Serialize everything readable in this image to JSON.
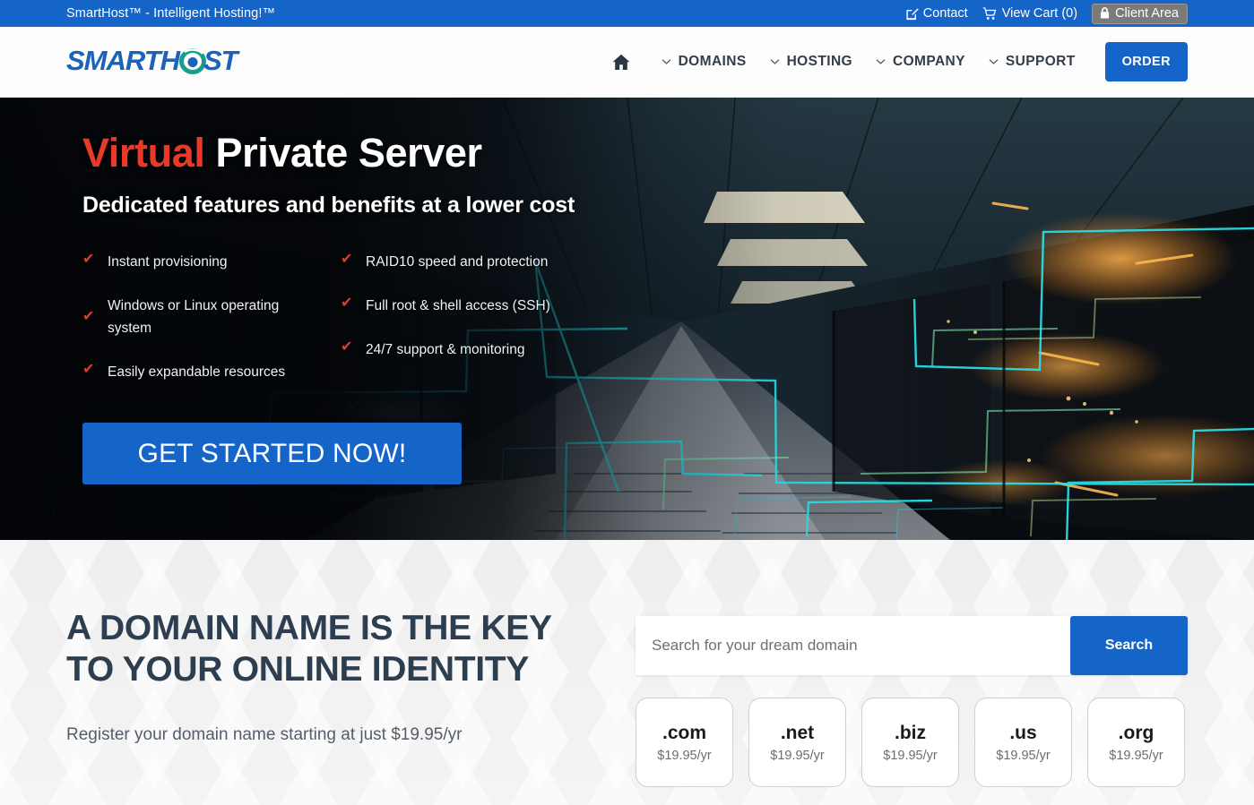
{
  "topbar": {
    "title": "SmartHost™ - Intelligent Hosting!™",
    "contact_label": "Contact",
    "contact_icon": "pencil-square-icon",
    "cart_label": "View Cart (0)",
    "cart_icon": "shopping-cart-icon",
    "client_area_label": "Client Area",
    "client_area_icon": "lock-icon",
    "background_color": "#1565c8",
    "client_area_bg": "#7b7b7b"
  },
  "header": {
    "logo_text": "SMARTHOST",
    "logo_colors": {
      "blue": "#1a63b8",
      "teal": "#189e8e"
    },
    "nav": {
      "home_icon": "home-icon",
      "items": [
        {
          "label": "DOMAINS",
          "icon": "chevron-down-icon"
        },
        {
          "label": "HOSTING",
          "icon": "chevron-down-icon"
        },
        {
          "label": "COMPANY",
          "icon": "chevron-down-icon"
        },
        {
          "label": "SUPPORT",
          "icon": "chevron-down-icon"
        }
      ],
      "order_label": "ORDER",
      "order_color": "#1565c8"
    }
  },
  "hero": {
    "title_accent": "Virtual",
    "title_rest": " Private Server",
    "accent_color": "#e8392b",
    "subtitle": "Dedicated features and benefits at a lower cost",
    "features_left": [
      "Instant provisioning",
      "Windows or Linux operating system",
      "Easily expandable resources"
    ],
    "features_right": [
      "RAID10 speed and protection",
      "Full root & shell access (SSH)",
      "24/7 support & monitoring"
    ],
    "check_icon": "check-icon",
    "check_glyph": "✔",
    "cta_label": "GET STARTED NOW!",
    "cta_color": "#1565c8"
  },
  "domain": {
    "heading_line1": "A DOMAIN NAME IS THE KEY",
    "heading_line2": "TO YOUR ONLINE IDENTITY",
    "heading_color": "#2d3e50",
    "note": "Register your domain name starting at just $19.95/yr",
    "search_placeholder": "Search for your dream domain",
    "search_value": "",
    "search_button_label": "Search",
    "search_button_color": "#1565c8",
    "tlds": [
      {
        "name": ".com",
        "price": "$19.95/yr"
      },
      {
        "name": ".net",
        "price": "$19.95/yr"
      },
      {
        "name": ".biz",
        "price": "$19.95/yr"
      },
      {
        "name": ".us",
        "price": "$19.95/yr"
      },
      {
        "name": ".org",
        "price": "$19.95/yr"
      }
    ]
  }
}
